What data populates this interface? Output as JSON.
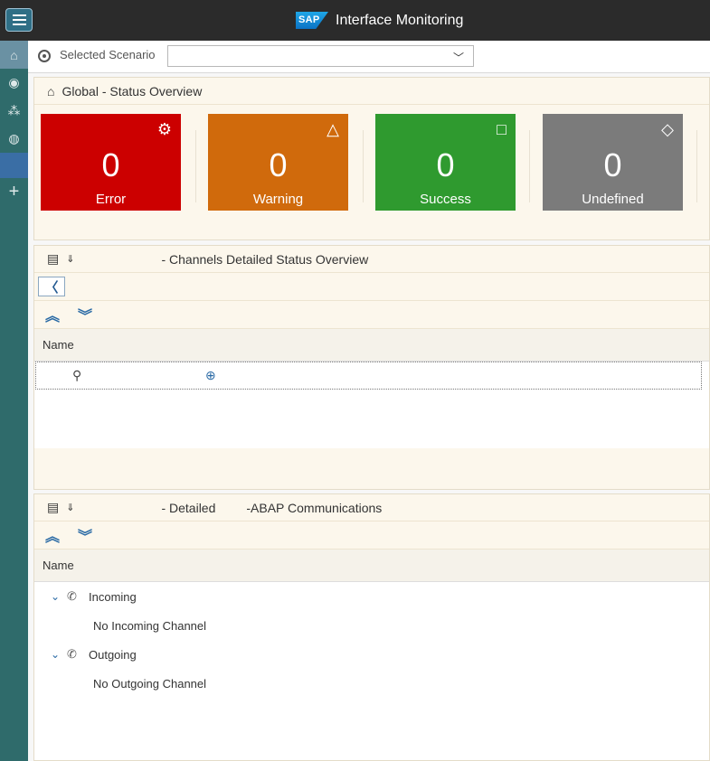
{
  "app": {
    "title": "Interface Monitoring",
    "logo_text": "SAP"
  },
  "scenario": {
    "label": "Selected Scenario",
    "value": ""
  },
  "global_panel": {
    "title": "Global - Status Overview",
    "cards": [
      {
        "label": "Error",
        "count": "0",
        "color": "#cc0000",
        "icon": "error-icon"
      },
      {
        "label": "Warning",
        "count": "0",
        "color": "#d06a0c",
        "icon": "warning-icon"
      },
      {
        "label": "Success",
        "count": "0",
        "color": "#2f9a2f",
        "icon": "success-icon"
      },
      {
        "label": "Undefined",
        "count": "0",
        "color": "#7b7b7b",
        "icon": "undefined-icon"
      }
    ]
  },
  "channels_panel": {
    "title": "- Channels Detailed Status Overview",
    "column_name": "Name"
  },
  "abap_panel": {
    "title_part1": "- Detailed",
    "title_part2": "-ABAP Communications",
    "column_name": "Name",
    "tree": [
      {
        "label": "Incoming",
        "child": "No Incoming Channel"
      },
      {
        "label": "Outgoing",
        "child": "No Outgoing Channel"
      }
    ]
  },
  "colors": {
    "shell": "#2b2b2b",
    "nav": "#2f6b6b",
    "panel": "#fcf7ec",
    "link": "#2a6aa5"
  }
}
